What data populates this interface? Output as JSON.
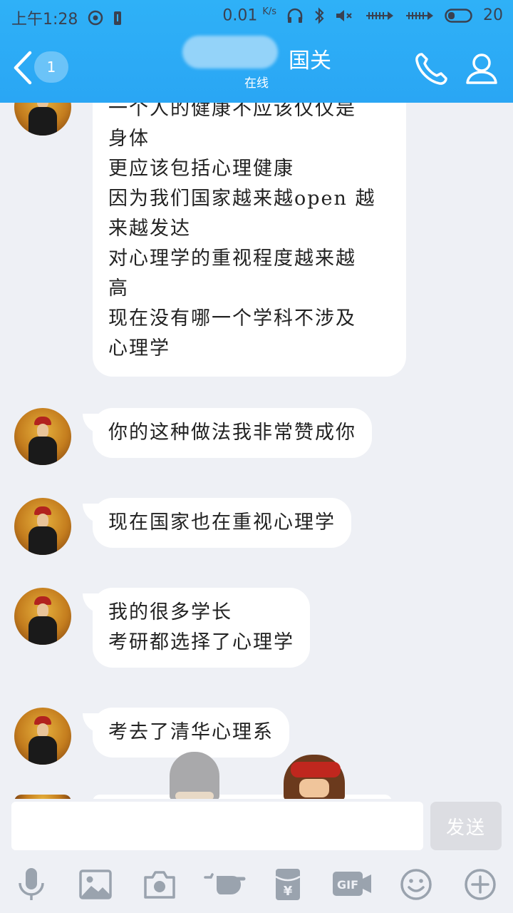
{
  "status_bar": {
    "time": "上午1:28",
    "network_speed": "0.01",
    "network_unit": "K/s",
    "battery": "20"
  },
  "header": {
    "back_badge": "1",
    "title": "国关",
    "subtitle": "在线"
  },
  "messages": [
    {
      "lines": [
        "一个人的健康不应该仅仅是",
        "身体",
        "更应该包括心理健康",
        "因为我们国家越来越open 越",
        "来越发达",
        "对心理学的重视程度越来越",
        "高",
        "现在没有哪一个学科不涉及",
        "心理学"
      ]
    },
    {
      "lines": [
        "你的这种做法我非常赞成你"
      ]
    },
    {
      "lines": [
        "现在国家也在重视心理学"
      ]
    },
    {
      "lines": [
        "我的很多学长",
        "考研都选择了心理学"
      ]
    },
    {
      "lines": [
        "考去了清华心理系"
      ]
    }
  ],
  "input": {
    "value": "",
    "send_label": "发送"
  },
  "toolbar": {
    "items": [
      "microphone-icon",
      "image-icon",
      "camera-icon",
      "poke-icon",
      "red-packet-icon",
      "gif-icon",
      "emoji-icon",
      "plus-icon"
    ],
    "gif_label": "GIF",
    "yuan_label": "¥"
  },
  "colors": {
    "header_blue": "#2aa6f4",
    "icon_gray": "#9aa3ae",
    "background": "#eef0f5"
  }
}
